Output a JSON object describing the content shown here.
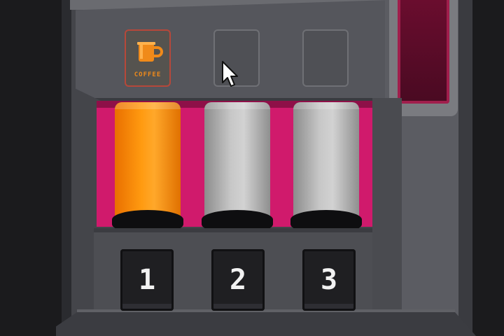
{
  "slots": [
    {
      "id": 1,
      "icon": "coffee-cup-icon",
      "label": "COFFEE",
      "filled": true
    },
    {
      "id": 2,
      "icon": "",
      "label": "",
      "filled": false
    },
    {
      "id": 3,
      "icon": "",
      "label": "",
      "filled": false
    }
  ],
  "tubes": [
    {
      "id": 1,
      "color": "#ff9a10",
      "filled": true
    },
    {
      "id": 2,
      "color": "#c7c7c7",
      "filled": false
    },
    {
      "id": 3,
      "color": "#c7c7c7",
      "filled": false
    }
  ],
  "buttons": [
    {
      "id": 1,
      "label": "1"
    },
    {
      "id": 2,
      "label": "2"
    },
    {
      "id": 3,
      "label": "3"
    }
  ],
  "colors": {
    "accent_orange": "#f08a1a",
    "bay_magenta": "#d01a6c",
    "indicator_red": "#6a0d2e",
    "machine_gray": "#44454a"
  }
}
